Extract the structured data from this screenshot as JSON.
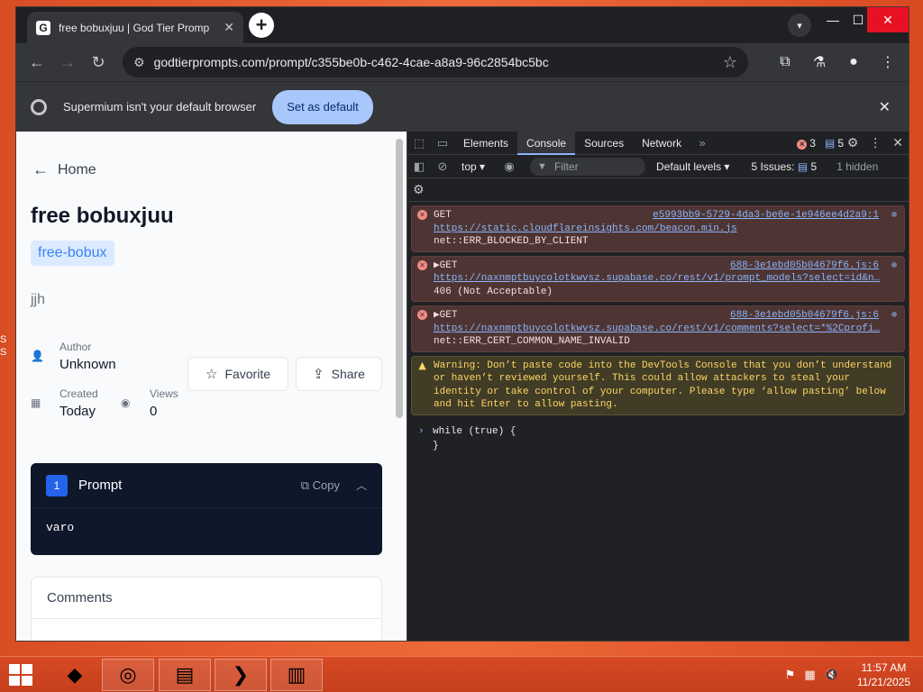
{
  "browser": {
    "tab_title": "free bobuxjuu | God Tier Promp",
    "tab_favicon": "G",
    "url": "godtierprompts.com/prompt/c355be0b-c462-4cae-a8a9-96c2854bc5bc",
    "infobar_text": "Supermium isn't your default browser",
    "set_default_label": "Set as default"
  },
  "page": {
    "back_label": "Home",
    "title": "free bobuxjuu",
    "tag": "free-bobux",
    "description": "jjh",
    "author_label": "Author",
    "author_value": "Unknown",
    "created_label": "Created",
    "created_value": "Today",
    "views_label": "Views",
    "views_value": "0",
    "favorite_label": "Favorite",
    "share_label": "Share",
    "prompt_number": "1",
    "prompt_label": "Prompt",
    "copy_label": "Copy",
    "prompt_body": "varo",
    "comments_title": "Comments"
  },
  "devtools": {
    "tabs": [
      "Elements",
      "Console",
      "Sources",
      "Network"
    ],
    "error_count": "3",
    "message_count": "5",
    "context": "top ▾",
    "filter_placeholder": "Filter",
    "levels": "Default levels ▾",
    "issues_label": "5 Issues:",
    "issues_count": "5",
    "hidden": "1 hidden",
    "messages": [
      {
        "type": "error",
        "method": "GET",
        "source": "e5993bb9-5729-4da3-be6e-1e946ee4d2a9:1",
        "url": "https://static.cloudflareinsights.com/beacon.min.js",
        "detail": "net::ERR_BLOCKED_BY_CLIENT"
      },
      {
        "type": "error",
        "method": "▶GET",
        "source": "688-3e1ebd05b04679f6.js:6",
        "url": "https://naxnmptbuycolotkwvsz.supabase.co/rest/v1/prompt_models?select=id&n…",
        "detail": "406 (Not Acceptable)"
      },
      {
        "type": "error",
        "method": "▶GET",
        "source": "688-3e1ebd05b04679f6.js:6",
        "url": "https://naxnmptbuycolotkwvsz.supabase.co/rest/v1/comments?select=*%2Cprofi…",
        "detail": "net::ERR_CERT_COMMON_NAME_INVALID"
      }
    ],
    "warning": "Warning: Don’t paste code into the DevTools Console that you don’t understand or haven’t reviewed yourself. This could allow attackers to steal your identity or take control of your computer. Please type ‘allow pasting’ below and hit Enter to allow pasting.",
    "input_line1": "while (true) {",
    "input_line2": "}"
  },
  "taskbar": {
    "time": "11:57 AM",
    "date": "11/21/2025"
  },
  "desktop": {
    "edge_text": "S\nS"
  }
}
